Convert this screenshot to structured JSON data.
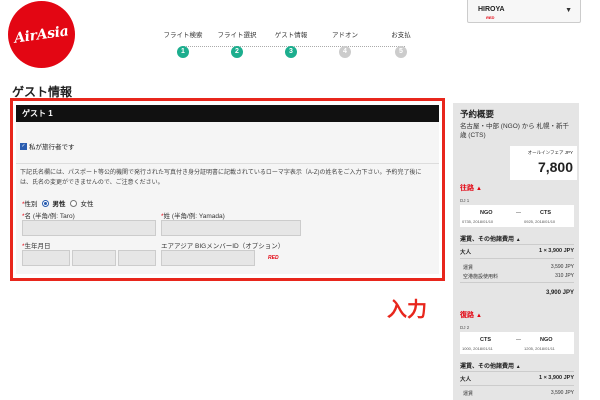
{
  "logo": {
    "text": "AirAsia"
  },
  "steps": [
    {
      "label": "フライト検索",
      "num": "1",
      "active": true
    },
    {
      "label": "フライト選択",
      "num": "2",
      "active": true
    },
    {
      "label": "ゲスト情報",
      "num": "3",
      "active": true
    },
    {
      "label": "アドオン",
      "num": "4",
      "active": false
    },
    {
      "label": "お支払",
      "num": "5",
      "active": false
    }
  ],
  "user": {
    "name": "HIROYA",
    "badge": "RED"
  },
  "page_title": "ゲスト情報",
  "guest": {
    "header": "ゲスト 1",
    "traveler_checkbox": "私が旅行者です",
    "notice": "下記氏名欄には、パスポート等公的機関で発行された写真付き身分証明書に記載されているローマ字表示（A-Z)の姓名をご入力下さい。予約完了後には、氏名の変更ができませんので、ご注意ください。",
    "gender_label": "性別",
    "gender_male": "男性",
    "gender_female": "女性",
    "first_name_label": "名 (半角/例: Taro)",
    "last_name_label": "姓 (半角/例: Yamada)",
    "dob_label": "生年月日",
    "member_id_label": "エアアジア BIGメンバーID（オプション）",
    "member_badge": "RED"
  },
  "annotation": "入力",
  "summary": {
    "title": "予約概要",
    "route": "名古屋・中部 (NGO) から 札幌・新千歳 (CTS)",
    "price_label": "オールインフェア JPY",
    "price": "7,800",
    "outbound": {
      "title": "往路",
      "code": "DJ 1",
      "from": "NGO",
      "to": "CTS",
      "dep_time": "0735, 2018/01/10",
      "arr_time": "0925, 2018/01/10",
      "fare_heading": "運賃、その他諸費用",
      "adult_label": "大人",
      "adult_value": "1 × 3,900 JPY",
      "fare_label": "運賃",
      "fare_value": "3,590 JPY",
      "fee_label": "空港施設使用料",
      "fee_value": "310 JPY",
      "total": "3,900 JPY"
    },
    "return": {
      "title": "復路",
      "code": "DJ 2",
      "from": "CTS",
      "to": "NGO",
      "dep_time": "1000, 2018/01/11",
      "arr_time": "1205, 2018/01/11",
      "fare_heading": "運賃、その他諸費用",
      "adult_label": "大人",
      "adult_value": "1 × 3,900 JPY",
      "fare_label": "運賃",
      "fare_value": "3,590 JPY"
    }
  }
}
